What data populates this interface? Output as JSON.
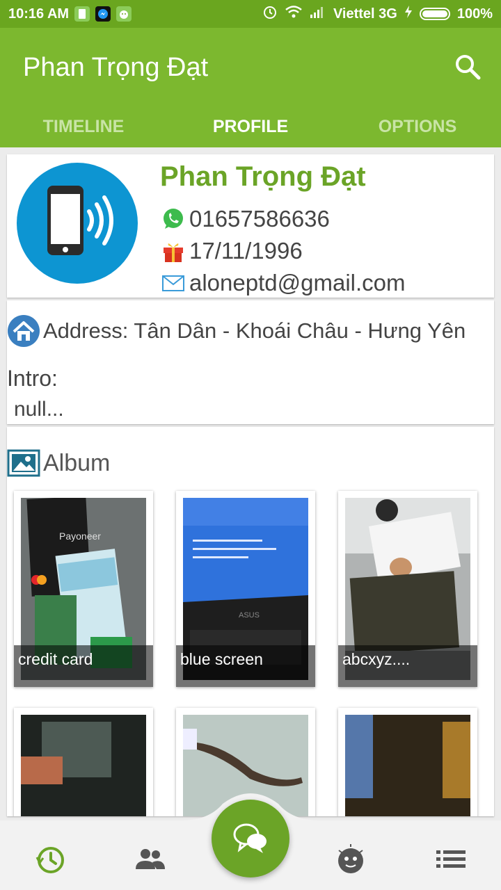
{
  "status_bar": {
    "time": "10:16 AM",
    "carrier": "Viettel 3G",
    "battery": "100%",
    "battery_level": 1.0
  },
  "app_bar": {
    "title": "Phan Trọng Đạt"
  },
  "tabs": [
    {
      "label": "TIMELINE",
      "active": false
    },
    {
      "label": "PROFILE",
      "active": true
    },
    {
      "label": "OPTIONS",
      "active": false
    }
  ],
  "profile": {
    "name": "Phan Trọng Đạt",
    "phone": "01657586636",
    "birthday": "17/11/1996",
    "email": "aloneptd@gmail.com"
  },
  "about": {
    "address": "Address: Tân Dân - Khoái Châu - Hưng Yên",
    "intro_label": "Intro:",
    "intro_text": "null..."
  },
  "album": {
    "title": "Album",
    "photos": [
      {
        "caption": "credit card"
      },
      {
        "caption": "blue screen"
      },
      {
        "caption": "abcxyz...."
      },
      {
        "caption": ""
      },
      {
        "caption": ""
      },
      {
        "caption": ""
      }
    ]
  },
  "colors": {
    "status_bar": "#6aa61f",
    "app_bar": "#7cb82f",
    "accent": "#6ba427",
    "avatar_bg": "#0d95d2"
  },
  "icons": {
    "search": "search-icon",
    "phone": "whatsapp-icon",
    "birthday": "gift-icon",
    "email": "mail-icon",
    "address": "home-icon",
    "album": "gallery-icon",
    "nav": [
      "timeline-icon",
      "friends-icon",
      "chat-icon",
      "emoji-icon",
      "menu-icon"
    ]
  }
}
